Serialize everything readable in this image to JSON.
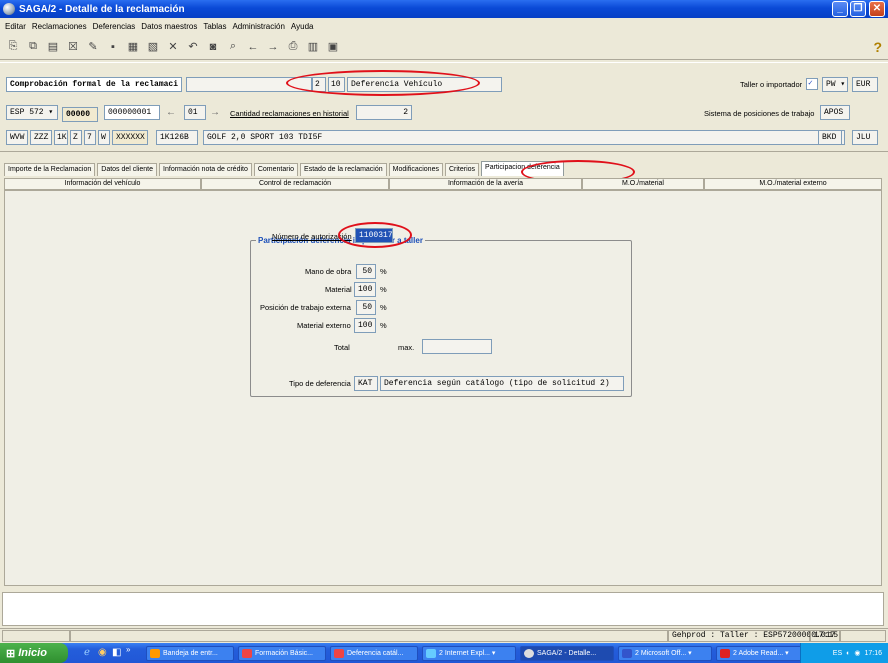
{
  "window": {
    "title": "SAGA/2 - Detalle de la reclamación"
  },
  "menu": [
    "Editar",
    "Reclamaciones",
    "Deferencias",
    "Datos maestros",
    "Tablas",
    "Administración",
    "Ayuda"
  ],
  "toolbar_icons": [
    "new-icon",
    "copy-icon",
    "save-icon",
    "delete-icon",
    "edit-icon",
    "floppy-icon",
    "print-preview-icon",
    "document-icon",
    "close-icon",
    "undo-icon",
    "binoculars-icon",
    "search-icon",
    "back-arrow-icon",
    "forward-arrow-icon",
    "printer-icon",
    "barcode-icon",
    "calendar-icon"
  ],
  "toolbar_help": "?",
  "header": {
    "comprobacion": "Comprobación formal de la reclamaci",
    "code1": "2",
    "code2": "10",
    "deferencia_tipo": "Deferencia Vehículo",
    "taller_importador_label": "Taller o importador",
    "taller_value": "PW",
    "currency": "EUR",
    "country": "ESP 572",
    "code_00000": "00000",
    "claim_number": "000000001",
    "hist_num": "01",
    "cantidad_label": "Cantidad reclamaciones en historial",
    "cantidad_value": "2",
    "sistema_label": "Sistema de posiciones de trabajo",
    "sistema_value": "APOS",
    "vin": [
      "WVW",
      "ZZZ",
      "1K",
      "Z",
      "7",
      "W",
      "XXXXXX"
    ],
    "model_code": "1K126B",
    "model_name": "GOLF 2,0 SPORT 103 TDI5F",
    "code_bkd": "BKD",
    "code_jlu": "JLU"
  },
  "tabs": [
    "Importe de la Reclamacion",
    "Datos del cliente",
    "Información nota de crédito",
    "Comentario",
    "Estado de la reclamación",
    "Modificaciones",
    "Criterios",
    "Participacion deferencia"
  ],
  "subtabs": [
    "Información del vehículo",
    "Control de reclamación",
    "Información de la avería",
    "M.O./material",
    "M.O./material externo"
  ],
  "group": {
    "title": "Participación deferencia importador a taller",
    "autorizacion_label": "Número de autorización",
    "autorizacion_value": "1100317",
    "mano_obra_label": "Mano de obra",
    "mano_obra_value": "50",
    "material_label": "Material",
    "material_value": "100",
    "pos_externa_label": "Posición de trabajo externa",
    "pos_externa_value": "50",
    "material_externo_label": "Material externo",
    "material_externo_value": "100",
    "percent": "%",
    "total_label": "Total",
    "max_label": "max.",
    "tipo_label": "Tipo de deferencia",
    "tipo_code": "KAT",
    "tipo_desc": "Deferencia según catálogo (tipo de solicitud 2)"
  },
  "statusbar": {
    "system": "Gehprod : Taller : ESP57200000.017",
    "time": "17:15"
  },
  "taskbar": {
    "start": "Inicio",
    "quicklaunch_more": "»",
    "buttons": [
      "Bandeja de entr...",
      "Formación Básic...",
      "Deferencia catál...",
      "2 Internet Expl...",
      "SAGA/2 - Detalle...",
      "2 Microsoft Off...",
      "2 Adobe Read..."
    ],
    "lang": "ES",
    "clock": "17:16"
  }
}
